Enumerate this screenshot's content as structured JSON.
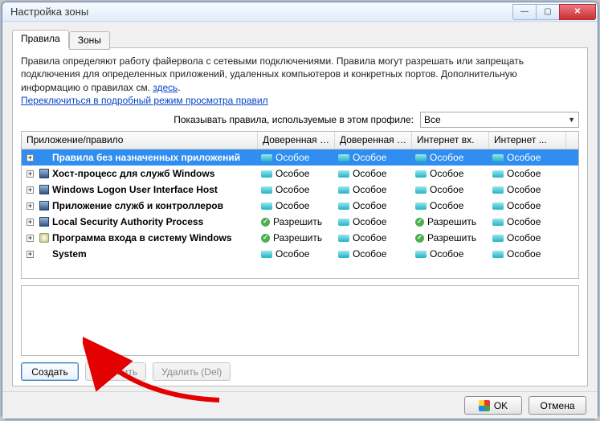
{
  "title": "Настройка зоны",
  "tabs": {
    "rules": "Правила",
    "zones": "Зоны",
    "active": 0
  },
  "desc": {
    "text1": "Правила определяют работу файервола с сетевыми подключениями. Правила могут разрешать или запрещать подключения для определенных приложений, удаленных компьютеров и конкретных портов. Дополнительную информацию о правилах см. ",
    "here": "здесь",
    "link": "Переключиться в подробный режим просмотра правил"
  },
  "filter": {
    "label": "Показывать правила, используемые в этом профиле:",
    "value": "Все"
  },
  "columns": [
    "Приложение/правило",
    "Доверенная з...",
    "Доверенная з...",
    "Интернет вх.",
    "Интернет ..."
  ],
  "rows": [
    {
      "name": "Правила без назначенных приложений",
      "icon": "blank",
      "s": [
        "special",
        "special",
        "special",
        "special"
      ],
      "sel": true
    },
    {
      "name": "Хост-процесс для служб Windows",
      "icon": "generic",
      "s": [
        "special",
        "special",
        "special",
        "special"
      ]
    },
    {
      "name": "Windows Logon User Interface Host",
      "icon": "generic",
      "s": [
        "special",
        "special",
        "special",
        "special"
      ]
    },
    {
      "name": "Приложение служб и контроллеров",
      "icon": "generic",
      "s": [
        "special",
        "special",
        "special",
        "special"
      ]
    },
    {
      "name": "Local Security Authority Process",
      "icon": "generic",
      "s": [
        "allow",
        "special",
        "allow",
        "special"
      ]
    },
    {
      "name": "Программа входа в систему Windows",
      "icon": "shield",
      "s": [
        "allow",
        "special",
        "allow",
        "special"
      ]
    },
    {
      "name": "System",
      "icon": "blank",
      "s": [
        "special",
        "special",
        "special",
        "special"
      ]
    }
  ],
  "status_labels": {
    "special": "Особое",
    "allow": "Разрешить"
  },
  "buttons": {
    "create": "Создать",
    "edit": "Изменить",
    "delete": "Удалить (Del)",
    "ok": "OK",
    "cancel": "Отмена"
  }
}
